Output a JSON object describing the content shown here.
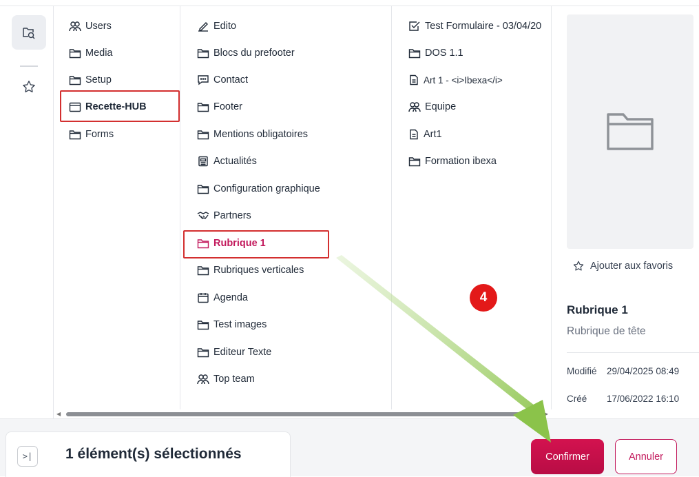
{
  "columns": {
    "col1": [
      {
        "label": "Users",
        "icon": "users-icon"
      },
      {
        "label": "Media",
        "icon": "folder-icon"
      },
      {
        "label": "Setup",
        "icon": "folder-icon"
      },
      {
        "label": "Recette-HUB",
        "icon": "window-icon",
        "selected": true
      },
      {
        "label": "Forms",
        "icon": "folder-icon"
      }
    ],
    "col2": [
      {
        "label": "Edito",
        "icon": "pen-icon"
      },
      {
        "label": "Blocs du prefooter",
        "icon": "folder-icon"
      },
      {
        "label": "Contact",
        "icon": "chat-icon"
      },
      {
        "label": "Footer",
        "icon": "folder-icon"
      },
      {
        "label": "Mentions obligatoires",
        "icon": "folder-icon"
      },
      {
        "label": "Actualités",
        "icon": "newspaper-icon"
      },
      {
        "label": "Configuration graphique",
        "icon": "folder-icon"
      },
      {
        "label": "Partners",
        "icon": "handshake-icon"
      },
      {
        "label": "Rubrique 1",
        "icon": "folder-icon",
        "selected": true
      },
      {
        "label": "Rubriques verticales",
        "icon": "folder-icon"
      },
      {
        "label": "Agenda",
        "icon": "calendar-icon"
      },
      {
        "label": "Test images",
        "icon": "folder-icon"
      },
      {
        "label": "Editeur Texte",
        "icon": "folder-icon"
      },
      {
        "label": "Top team",
        "icon": "users-icon"
      }
    ],
    "col3": [
      {
        "label": "Test Formulaire - 03/04/20",
        "icon": "checkbox-icon"
      },
      {
        "label": "DOS 1.1",
        "icon": "folder-icon"
      },
      {
        "label": "Art 1 - <i>Ibexa</i>",
        "icon": "document-icon"
      },
      {
        "label": "Equipe",
        "icon": "users-icon"
      },
      {
        "label": "Art1",
        "icon": "document-icon"
      },
      {
        "label": "Formation ibexa",
        "icon": "folder-icon"
      }
    ]
  },
  "preview": {
    "favorite_label": "Ajouter aux favoris",
    "title": "Rubrique 1",
    "subtitle": "Rubrique de tête",
    "modified_label": "Modifié",
    "modified_value": "29/04/2025 08:49",
    "created_label": "Créé",
    "created_value": "17/06/2022 16:10"
  },
  "footer": {
    "expand_glyph": ">|",
    "selection_text": "1 élément(s) sélectionnés",
    "confirm_label": "Confirmer",
    "cancel_label": "Annuler"
  },
  "annotation": {
    "step_number": "4",
    "badge_color": "#e31919",
    "arrow_color": "#8bc34a",
    "highlight_color": "#d32f2f"
  },
  "colors": {
    "accent": "#c2185b",
    "confirm_bg": "#c8104a"
  }
}
